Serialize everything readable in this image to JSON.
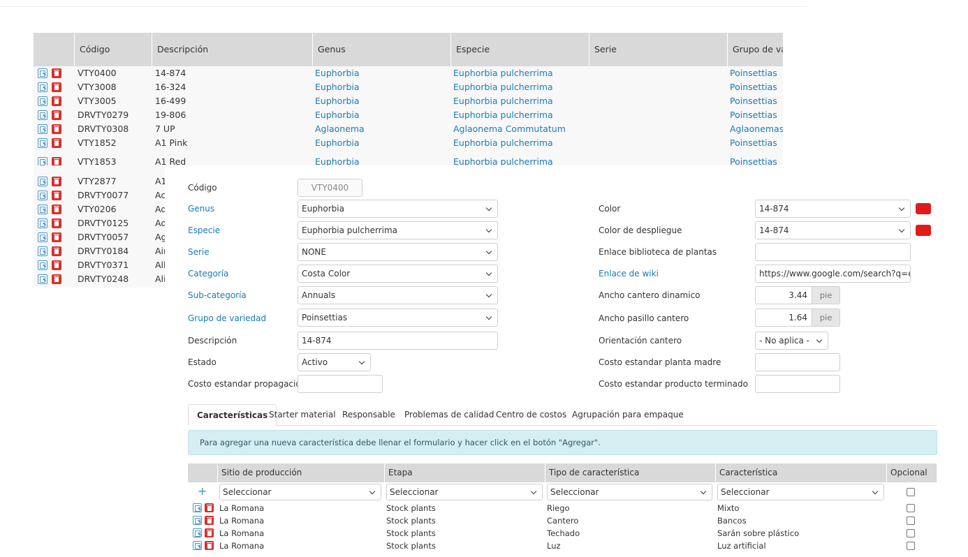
{
  "varieties_table": {
    "columns": [
      "Código",
      "Descripción",
      "Genus",
      "Especie",
      "Serie",
      "Grupo de vari"
    ],
    "rows": [
      {
        "codigo": "VTY0400",
        "descripcion": "14-874",
        "genus": "Euphorbia",
        "especie": "Euphorbia pulcherrima",
        "serie": "",
        "grupo": "Poinsettias"
      },
      {
        "codigo": "VTY3008",
        "descripcion": "16-324",
        "genus": "Euphorbia",
        "especie": "Euphorbia pulcherrima",
        "serie": "",
        "grupo": "Poinsettias"
      },
      {
        "codigo": "VTY3005",
        "descripcion": "16-499",
        "genus": "Euphorbia",
        "especie": "Euphorbia pulcherrima",
        "serie": "",
        "grupo": "Poinsettias"
      },
      {
        "codigo": "DRVTY0279",
        "descripcion": "19-806",
        "genus": "Euphorbia",
        "especie": "Euphorbia pulcherrima",
        "serie": "",
        "grupo": "Poinsettias"
      },
      {
        "codigo": "DRVTY0308",
        "descripcion": "7 UP",
        "genus": "Aglaonema",
        "especie": "Aglaonema Commutatum",
        "serie": "",
        "grupo": "Aglaonemas"
      },
      {
        "codigo": "VTY1852",
        "descripcion": "A1 Pink",
        "genus": "Euphorbia",
        "especie": "Euphorbia pulcherrima",
        "serie": "",
        "grupo": "Poinsettias"
      },
      {
        "codigo": "VTY1853",
        "descripcion": "A1 Red",
        "genus": "Euphorbia",
        "especie": "Euphorbia pulcherrima",
        "serie": "",
        "grupo": "Poinsettias"
      }
    ],
    "hidden_rows": [
      {
        "codigo": "VTY2877",
        "descripcion": "A1"
      },
      {
        "codigo": "DRVTY0077",
        "descripcion": "Acr"
      },
      {
        "codigo": "VTY0206",
        "descripcion": "Ad"
      },
      {
        "codigo": "DRVTY0125",
        "descripcion": "Ad"
      },
      {
        "codigo": "DRVTY0057",
        "descripcion": "Ag"
      },
      {
        "codigo": "DRVTY0184",
        "descripcion": "Ain"
      },
      {
        "codigo": "DRVTY0371",
        "descripcion": "Alb"
      },
      {
        "codigo": "DRVTY0248",
        "descripcion": "Ali"
      }
    ]
  },
  "form": {
    "codigo": {
      "label": "Código",
      "value": "VTY0400"
    },
    "genus": {
      "label": "Genus",
      "value": "Euphorbia"
    },
    "especie": {
      "label": "Especie",
      "value": "Euphorbia pulcherrima"
    },
    "serie": {
      "label": "Serie",
      "value": "NONE"
    },
    "categoria": {
      "label": "Categoría",
      "value": "Costa Color"
    },
    "subcategoria": {
      "label": "Sub-categoría",
      "value": "Annuals"
    },
    "grupo": {
      "label": "Grupo de variedad",
      "value": "Poinsettias"
    },
    "descripcion": {
      "label": "Descripción",
      "value": "14-874"
    },
    "estado": {
      "label": "Estado",
      "value": "Activo"
    },
    "costo_prop": {
      "label": "Costo estandar propagación",
      "value": ""
    },
    "color": {
      "label": "Color",
      "value": "14-874",
      "swatch": "#e01b1b"
    },
    "color_desp": {
      "label": "Color de despliegue",
      "value": "14-874",
      "swatch": "#e01b1b"
    },
    "enlace_bib": {
      "label": "Enlace biblioteca de plantas",
      "value": ""
    },
    "enlace_wiki": {
      "label": "Enlace de wiki",
      "value": "https://www.google.com/search?q=euphor"
    },
    "ancho_cantero": {
      "label": "Ancho cantero dinamico",
      "value": "3.44",
      "unit": "pie"
    },
    "ancho_pasillo": {
      "label": "Ancho pasillo cantero",
      "value": "1.64",
      "unit": "pie"
    },
    "orientacion": {
      "label": "Orientación cantero",
      "value": "- No aplica -"
    },
    "costo_madre": {
      "label": "Costo estandar planta madre",
      "value": ""
    },
    "costo_term": {
      "label": "Costo estandar producto terminado",
      "value": ""
    }
  },
  "tabs": [
    "Características",
    "Starter material",
    "Responsable",
    "Problemas de calidad",
    "Centro de costos",
    "Agrupación para empaque"
  ],
  "alert": "Para agregar una nueva característica debe llenar el formulario y hacer click en el botón \"Agregar\".",
  "characteristics": {
    "columns": [
      "Sitio de producción",
      "Etapa",
      "Tipo de característica",
      "Característica",
      "Opcional"
    ],
    "add_symbol": "+",
    "filter_placeholder": "Seleccionar",
    "rows": [
      {
        "sitio": "La Romana",
        "etapa": "Stock plants",
        "tipo": "Riego",
        "caracteristica": "Mixto"
      },
      {
        "sitio": "La Romana",
        "etapa": "Stock plants",
        "tipo": "Cantero",
        "caracteristica": "Bancos"
      },
      {
        "sitio": "La Romana",
        "etapa": "Stock plants",
        "tipo": "Techado",
        "caracteristica": "Sarán sobre plástico"
      },
      {
        "sitio": "La Romana",
        "etapa": "Stock plants",
        "tipo": "Luz",
        "caracteristica": "Luz artificial"
      }
    ]
  }
}
